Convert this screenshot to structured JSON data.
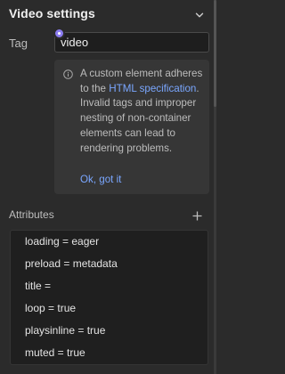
{
  "header": {
    "title": "Video settings",
    "collapse_icon": "chevron-down-icon"
  },
  "tag": {
    "label": "Tag",
    "value": "video"
  },
  "info": {
    "icon": "info-icon",
    "text_before": "A custom element adheres to the ",
    "link": "HTML specification",
    "text_after": ". Invalid tags and improper nesting of non-container elements can lead to rendering problems.",
    "dismiss": "Ok, got it"
  },
  "attributes": {
    "label": "Attributes",
    "add_icon": "plus-icon",
    "items": [
      "loading = eager",
      "preload = metadata",
      "title =",
      "loop = true",
      "playsinline = true",
      "muted = true"
    ]
  },
  "colors": {
    "panel_bg": "#2b2b2b",
    "input_bg": "#1e1e1e",
    "info_bg": "#363636",
    "link": "#7aa7ff",
    "accent": "#8b7cf0"
  }
}
